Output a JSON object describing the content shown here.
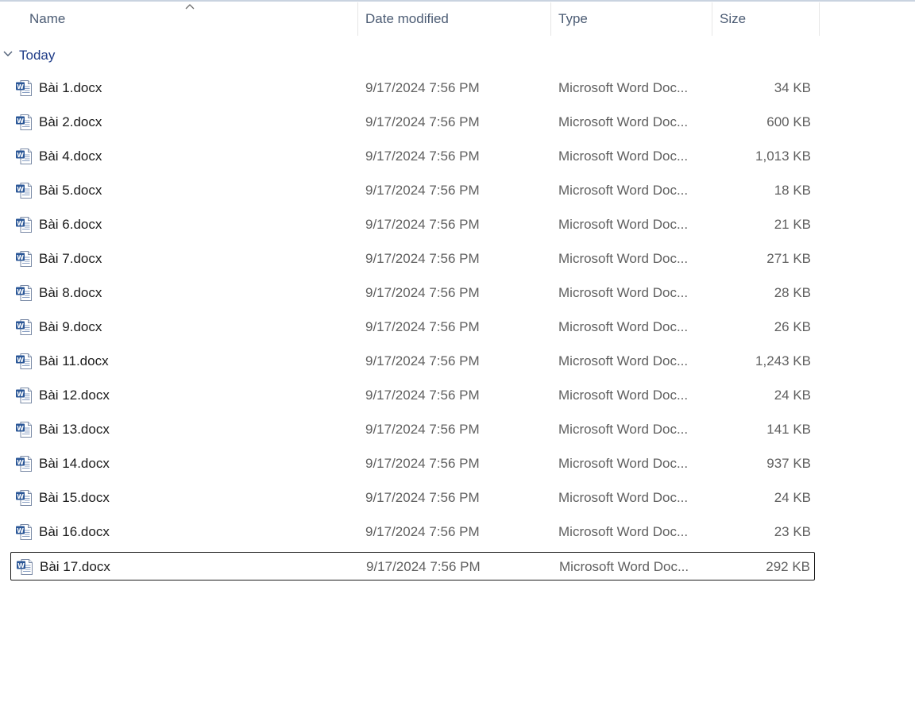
{
  "columns": {
    "name": "Name",
    "date": "Date modified",
    "type": "Type",
    "size": "Size"
  },
  "sort": {
    "column": "name",
    "icon": "sort-ascending-icon"
  },
  "group": {
    "label": "Today",
    "icon": "chevron-down-icon"
  },
  "colors": {
    "header_text": "#4c5c74",
    "group_text": "#1f3c88",
    "icon_blue": "#2b5797"
  },
  "files": [
    {
      "name": "Bài 1.docx",
      "date": "9/17/2024 7:56 PM",
      "type": "Microsoft Word Doc...",
      "size": "34 KB"
    },
    {
      "name": "Bài 2.docx",
      "date": "9/17/2024 7:56 PM",
      "type": "Microsoft Word Doc...",
      "size": "600 KB"
    },
    {
      "name": "Bài 4.docx",
      "date": "9/17/2024 7:56 PM",
      "type": "Microsoft Word Doc...",
      "size": "1,013 KB"
    },
    {
      "name": "Bài 5.docx",
      "date": "9/17/2024 7:56 PM",
      "type": "Microsoft Word Doc...",
      "size": "18 KB"
    },
    {
      "name": "Bài 6.docx",
      "date": "9/17/2024 7:56 PM",
      "type": "Microsoft Word Doc...",
      "size": "21 KB"
    },
    {
      "name": "Bài 7.docx",
      "date": "9/17/2024 7:56 PM",
      "type": "Microsoft Word Doc...",
      "size": "271 KB"
    },
    {
      "name": "Bài 8.docx",
      "date": "9/17/2024 7:56 PM",
      "type": "Microsoft Word Doc...",
      "size": "28 KB"
    },
    {
      "name": "Bài 9.docx",
      "date": "9/17/2024 7:56 PM",
      "type": "Microsoft Word Doc...",
      "size": "26 KB"
    },
    {
      "name": "Bài 11.docx",
      "date": "9/17/2024 7:56 PM",
      "type": "Microsoft Word Doc...",
      "size": "1,243 KB"
    },
    {
      "name": "Bài 12.docx",
      "date": "9/17/2024 7:56 PM",
      "type": "Microsoft Word Doc...",
      "size": "24 KB"
    },
    {
      "name": "Bài 13.docx",
      "date": "9/17/2024 7:56 PM",
      "type": "Microsoft Word Doc...",
      "size": "141 KB"
    },
    {
      "name": "Bài 14.docx",
      "date": "9/17/2024 7:56 PM",
      "type": "Microsoft Word Doc...",
      "size": "937 KB"
    },
    {
      "name": "Bài 15.docx",
      "date": "9/17/2024 7:56 PM",
      "type": "Microsoft Word Doc...",
      "size": "24 KB"
    },
    {
      "name": "Bài 16.docx",
      "date": "9/17/2024 7:56 PM",
      "type": "Microsoft Word Doc...",
      "size": "23 KB"
    },
    {
      "name": "Bài 17.docx",
      "date": "9/17/2024 7:56 PM",
      "type": "Microsoft Word Doc...",
      "size": "292 KB",
      "selected": true
    }
  ]
}
